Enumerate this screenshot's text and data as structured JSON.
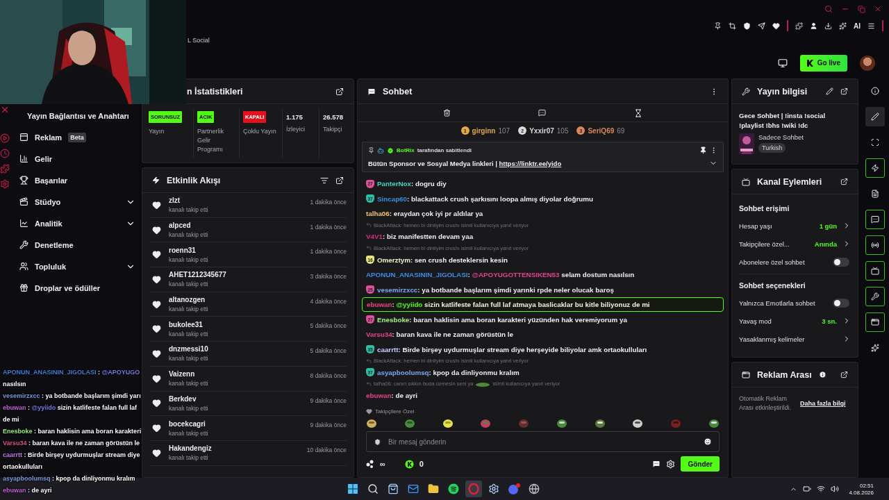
{
  "browser": {
    "tab_text": "L Social",
    "toolbar_label": "AI"
  },
  "header": {
    "go_live": "Go live"
  },
  "sidebar": {
    "items": [
      {
        "label": "Yayın Bağlantısı ve Anahtarı",
        "expandable": false
      },
      {
        "label": "Reklam",
        "tag": "Beta",
        "expandable": false
      },
      {
        "label": "Gelir",
        "expandable": false
      },
      {
        "label": "Başarılar",
        "expandable": false
      },
      {
        "label": "Stüdyo",
        "expandable": true
      },
      {
        "label": "Analitik",
        "expandable": true
      },
      {
        "label": "Denetleme",
        "expandable": false
      },
      {
        "label": "Topluluk",
        "expandable": true
      },
      {
        "label": "Droplar ve ödüller",
        "expandable": false
      }
    ]
  },
  "stats": {
    "title": "n İstatistikleri",
    "items": [
      {
        "kind": "status",
        "badge": "SORUNSUZ",
        "color": "#53fc18",
        "label": "Yayın"
      },
      {
        "kind": "status",
        "badge": "ACIK",
        "color": "#53fc18",
        "label": "Partnerlik Gelir Programı"
      },
      {
        "kind": "status",
        "badge": "KAPALI",
        "color": "#e3101e",
        "label": "Çoklu Yayın"
      },
      {
        "kind": "value",
        "value": "1.175",
        "label": "İzleyici"
      },
      {
        "kind": "value",
        "value": "26.578",
        "label": "Takipçi"
      }
    ]
  },
  "activity": {
    "title": "Etkinlik Akışı",
    "events": [
      {
        "user": "zlzt",
        "action": "kanalı takip etti",
        "time": "1 dakika önce"
      },
      {
        "user": "alpced",
        "action": "kanalı takip etti",
        "time": "1 dakika önce"
      },
      {
        "user": "roenn31",
        "action": "kanalı takip etti",
        "time": "1 dakika önce"
      },
      {
        "user": "AHET1212345677",
        "action": "kanalı takip etti",
        "time": "3 dakika önce"
      },
      {
        "user": "altanozgen",
        "action": "kanalı takip etti",
        "time": "4 dakika önce"
      },
      {
        "user": "bukolee31",
        "action": "kanalı takip etti",
        "time": "5 dakika önce"
      },
      {
        "user": "dnzmessi10",
        "action": "kanalı takip etti",
        "time": "5 dakika önce"
      },
      {
        "user": "Vaizenn",
        "action": "kanalı takip etti",
        "time": "8 dakika önce"
      },
      {
        "user": "Berkdev",
        "action": "kanalı takip etti",
        "time": "9 dakika önce"
      },
      {
        "user": "bocekcagri",
        "action": "kanalı takip etti",
        "time": "9 dakika önce"
      },
      {
        "user": "Hakandengiz",
        "action": "kanalı takip etti",
        "time": "10 dakika önce"
      }
    ]
  },
  "chat": {
    "title": "Sohbet",
    "leaderboard": [
      {
        "rank": "1",
        "user": "girginn",
        "points": "107",
        "color": "#e0a84a"
      },
      {
        "rank": "2",
        "user": "Yxxir07",
        "points": "105",
        "color": "#d8d8dc"
      },
      {
        "rank": "3",
        "user": "SeriQ69",
        "points": "69",
        "color": "#d9875a"
      }
    ],
    "pinned": {
      "author": "BotRix",
      "note": "tarafından sabitlendi",
      "text": "Bütün Sponsor ve Sosyal Medya linkleri | ",
      "link": "https://linktr.ee/yido"
    },
    "messages": [
      {
        "badge": {
          "text": "27",
          "color": "#e0509a"
        },
        "user": "PanterNox",
        "color": "#3fd6c0",
        "sep": ":",
        "text": "dogru diy",
        "highlighted": false
      },
      {
        "badge": {
          "text": "37",
          "color": "#2bbfa8"
        },
        "user": "Sincap60",
        "color": "#3a8fe0",
        "sep": ":",
        "text": "blackattack crush şarkısını loopa almış diyolar doğrumu",
        "highlighted": false
      },
      {
        "user": "talha06",
        "color": "#f2c46a",
        "sep": ":",
        "text": "eraydan çok iyi pr aldılar ya",
        "highlighted": false
      },
      {
        "reply": [
          "BlackAttack: hemen bi dinliyim crushı isimli kullanıcıya yanıt veriyor"
        ],
        "user": "V4V1",
        "color": "#d0307f",
        "sep": ":",
        "text": "biz manifestten devam yaa",
        "highlighted": false
      },
      {
        "reply": [
          "BlackAttack: hemen bi dinliyim crushı isimli kullanıcıya yanıt veriyor"
        ],
        "badge": {
          "text": "16",
          "color": "#e8e07a"
        },
        "user": "Omerztym",
        "color": "#f0f0c8",
        "sep": ":",
        "text": "sen crush desteklersin kesin",
        "highlighted": false
      },
      {
        "user": "APONUN_ANASININ_JIGOLASI",
        "color": "#3a8fe6",
        "sep": ":",
        "mention": {
          "text": "@APOYUGOTTENSIKEN53",
          "color": "#e8408f"
        },
        "text": "selam dostum nasılsın",
        "highlighted": false
      },
      {
        "badge": {
          "text": "25",
          "color": "#e0509a"
        },
        "user": "vesemirzxcc",
        "color": "#7aa6f2",
        "sep": ":",
        "text": "ya botbande başlarım şimdi yarınki rpde neler olucak baroş",
        "highlighted": false
      },
      {
        "user": "ebuwan",
        "color": "#e8408f",
        "sep": ":",
        "mention": {
          "text": "@yyiido",
          "color": "#53fc18"
        },
        "text": "sizin katlifeste falan full laf atmaya baslicaklar bu kitle biliyonuz de mi",
        "highlighted": true
      },
      {
        "badge": {
          "text": "27",
          "color": "#e0509a"
        },
        "user": "Enesboke",
        "color": "#a6f07a",
        "sep": ":",
        "text": "baran haklisin ama boran karakteri yüzünden hak veremiyorum ya",
        "highlighted": false
      },
      {
        "user": "Varsu34",
        "color": "#e8408f",
        "sep": ":",
        "text": "baran kava ile ne zaman görüstün le",
        "highlighted": false
      },
      {
        "badge": {
          "text": "35",
          "color": "#2bbfa8"
        },
        "user": "caarrtt",
        "color": "#c8ccff",
        "sep": ":",
        "text": "Birde birşey uydurmuşlar stream diye herşeyide biliyolar amk ortaokulluları",
        "highlighted": false
      },
      {
        "reply": [
          "BlackAttack: hemen bi dinliyim crushı isimli kullanıcıya yanıt veriyor"
        ],
        "badge": {
          "text": "37",
          "color": "#2bbfa8"
        },
        "user": "asyapboolumsq",
        "color": "#7aa6f2",
        "sep": ":",
        "text": "kpop da dinliyonmu kralım",
        "highlighted": false
      },
      {
        "reply": [
          "talha06: canın sıkkın buda üzmesin seni ya",
          "isimli kullanıcıya yanıt veriyor"
        ],
        "user": "ebuwan",
        "color": "#e8408f",
        "sep": ":",
        "text": "de ayri",
        "highlighted": false
      }
    ],
    "emote_set": "Takipçilere Özel",
    "input": {
      "placeholder": "Bir mesaj gönderin"
    },
    "points": "∞",
    "coins": "0",
    "send": "Gönder"
  },
  "stream_info": {
    "title": "Yayın bilgisi",
    "stream_title": "Gece Sohbet | !insta !social !playlist !bhs !wiki !dc",
    "category": "Sadece Sohbet",
    "tag": "Turkish"
  },
  "channel_actions": {
    "title": "Kanal Eylemleri",
    "sections": [
      {
        "title": "Sohbet erişimi",
        "rows": [
          {
            "kind": "value",
            "label": "Hesap yaşı",
            "value": "1 gün"
          },
          {
            "kind": "value",
            "label": "Takipçilere özel...",
            "value": "Anında"
          },
          {
            "kind": "toggle",
            "label": "Abonelere özel sohbet",
            "on": false
          }
        ]
      },
      {
        "title": "Sohbet seçenekleri",
        "rows": [
          {
            "kind": "toggle",
            "label": "Yalnızca Emotlarla sohbet",
            "on": false
          },
          {
            "kind": "value",
            "label": "Yavaş mod",
            "value": "3 sn."
          },
          {
            "kind": "link",
            "label": "Yasaklanmış kelimeler"
          }
        ]
      }
    ]
  },
  "ad_break": {
    "title": "Reklam Arası",
    "text": "Otomatik Reklam Arası etkinleştirildi.",
    "link": "Daha fazla bilgi"
  },
  "rail": [
    {
      "active": false,
      "selected": false
    },
    {
      "active": false,
      "selected": true
    },
    {
      "active": false,
      "selected": false
    },
    {
      "active": true,
      "selected": false
    },
    {
      "active": false,
      "selected": false
    },
    {
      "active": true,
      "selected": false
    },
    {
      "active": true,
      "selected": false
    },
    {
      "active": true,
      "selected": false
    },
    {
      "active": true,
      "selected": false
    },
    {
      "active": true,
      "selected": false
    },
    {
      "active": false,
      "selected": false
    }
  ],
  "overlay_chat": [
    {
      "user": "APONUN_ANASININ_JIGOLASI",
      "color": "#3f7fd6",
      "sep": ":",
      "lines": [
        {
          "text": "@APOYUGO",
          "color": "#7a7ae8"
        },
        {
          "text": "nasılsın"
        }
      ]
    },
    {
      "user": "vesemirzxcc",
      "color": "#7a9ae0",
      "sep": ":",
      "lines": [
        {
          "text": "ya botbande başlarım şimdi yarı"
        }
      ]
    },
    {
      "user": "ebuwan",
      "color": "#c460d8",
      "sep": ":",
      "lines": [
        {
          "text": "@yyiido",
          "color": "#7a7ae8",
          "rest": "sizin katlifeste falan full laf"
        },
        {
          "text": "de mi"
        }
      ]
    },
    {
      "user": "Enesboke",
      "color": "#9aee7a",
      "sep": ":",
      "lines": [
        {
          "text": "baran haklisin ama boran karakteri"
        }
      ]
    },
    {
      "user": "Varsu34",
      "color": "#e0508a",
      "sep": ":",
      "lines": [
        {
          "text": "baran kava ile ne zaman görüstün le"
        }
      ]
    },
    {
      "user": "caarrtt",
      "color": "#c47ae8",
      "sep": ":",
      "lines": [
        {
          "text": "Birde birşey uydurmuşlar stream diye"
        },
        {
          "text": "ortaokulluları"
        }
      ]
    },
    {
      "user": "asyapboolumsq",
      "color": "#7a9ae0",
      "sep": ":",
      "lines": [
        {
          "text": "kpop da dinliyonmu kralım"
        }
      ]
    },
    {
      "user": "ebuwan",
      "color": "#c460d8",
      "sep": ":",
      "lines": [
        {
          "text": "de ayri"
        }
      ]
    }
  ],
  "taskbar": {
    "apps": [
      {
        "selected": false
      },
      {
        "selected": false
      },
      {
        "selected": false
      },
      {
        "selected": false
      },
      {
        "selected": false
      },
      {
        "selected": false
      },
      {
        "selected": true
      },
      {
        "selected": false
      },
      {
        "selected": false
      },
      {
        "selected": false
      }
    ],
    "time": "02:51",
    "date": "4.08.2026"
  }
}
